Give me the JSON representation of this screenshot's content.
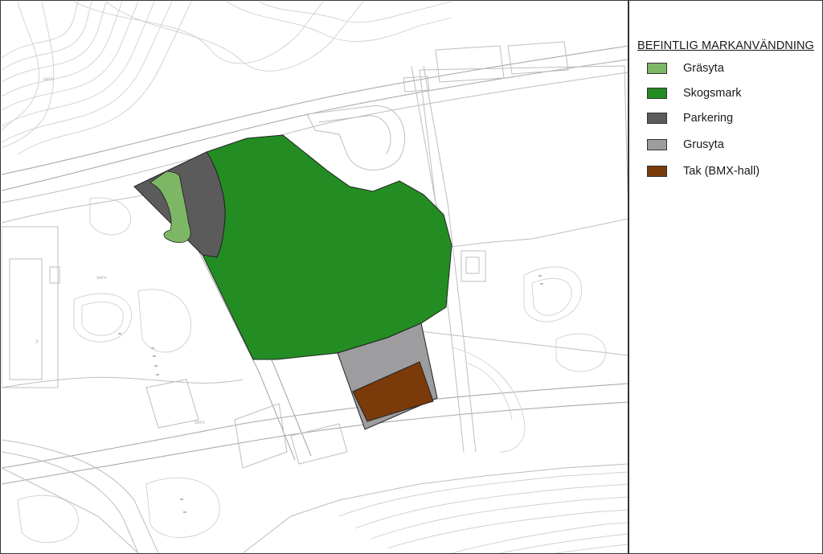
{
  "legend": {
    "title": "BEFINTLIG MARKANVÄNDNING",
    "items": [
      {
        "label": "Gräsyta",
        "color": "#7db766"
      },
      {
        "label": "Skogsmark",
        "color": "#238d24"
      },
      {
        "label": "Parkering",
        "color": "#5b5b5b"
      },
      {
        "label": "Grusyta",
        "color": "#9d9d9f"
      },
      {
        "label": "Tak (BMX-hall)",
        "color": "#7b3a0a"
      }
    ]
  },
  "map": {
    "labels": [
      "serv",
      "serv",
      "serv",
      "3"
    ],
    "zone_colors": {
      "grasyta": "#7db766",
      "skogsmark": "#238d24",
      "parkering": "#5b5b5b",
      "grusyta": "#9d9d9f",
      "tak": "#7b3a0a"
    }
  }
}
